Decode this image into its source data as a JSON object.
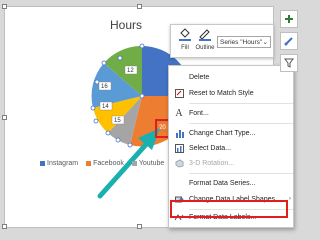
{
  "chart": {
    "title": "Hours",
    "legend": [
      "Instagram",
      "Facebook",
      "Youtube",
      "Ho"
    ],
    "colors": {
      "blue": "#4472c4",
      "orange": "#ed7d31",
      "gray": "#a5a5a5",
      "gold": "#ffc000",
      "lightblue": "#5b9bd5",
      "green": "#70ad47"
    },
    "data_labels": [
      "16",
      "14",
      "15",
      "12",
      "20"
    ]
  },
  "mini_toolbar": {
    "fill_label": "Fill",
    "outline_label": "Outline",
    "series_select": "Series \"Hours\""
  },
  "context_menu": {
    "items": [
      {
        "label": "Delete",
        "icon": ""
      },
      {
        "label": "Reset to Match Style",
        "icon": "reset-icon"
      },
      {
        "label": "Font...",
        "icon": "font-icon"
      },
      {
        "label": "Change Chart Type...",
        "icon": "chart-type-icon"
      },
      {
        "label": "Select Data...",
        "icon": "select-data-icon"
      },
      {
        "label": "3-D Rotation...",
        "icon": "rotation-icon"
      },
      {
        "label": "Format Data Series...",
        "icon": ""
      },
      {
        "label": "Change Data Label Shapes",
        "icon": "shapes-icon"
      },
      {
        "label": "Format Data Labels...",
        "icon": "format-labels-icon"
      }
    ]
  },
  "annotation": {
    "arrow_color": "#1ab0b0",
    "highlight_color": "#e31c1c"
  },
  "right_toolbar": [
    "plus-icon",
    "brush-icon",
    "filter-icon"
  ]
}
